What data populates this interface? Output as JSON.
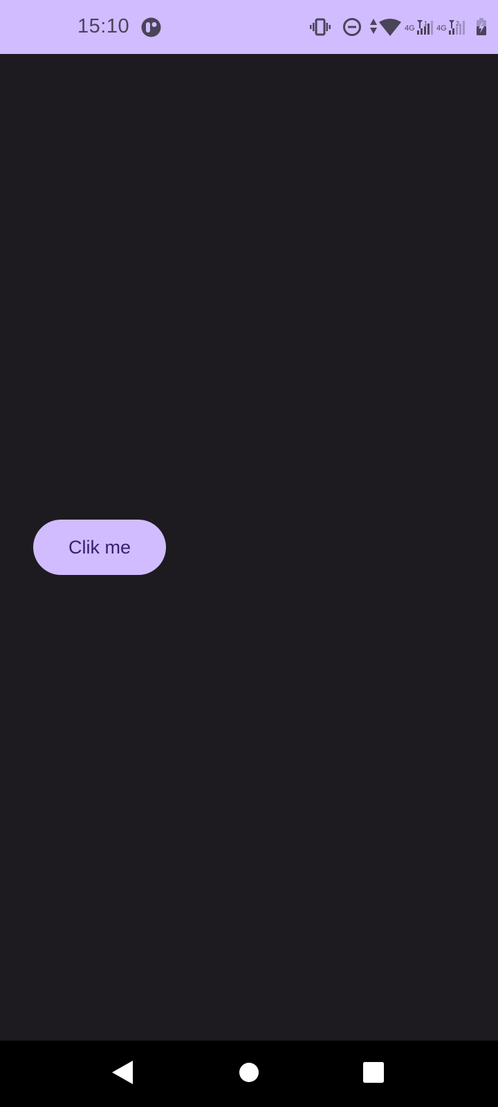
{
  "status_bar": {
    "time": "15:10",
    "icons": [
      "app-notification-icon",
      "vibrate-icon",
      "do-not-disturb-icon",
      "data-activity-icon",
      "wifi-icon",
      "signal-sim1-icon",
      "signal-sim2-icon",
      "battery-charging-icon"
    ],
    "network_sim1": "4G",
    "network_sim2": "4G",
    "sim1_index": "1",
    "sim2_index": "2"
  },
  "main": {
    "button_label": "Clik me"
  },
  "nav_bar": {
    "icons": [
      "back-icon",
      "home-icon",
      "recents-icon"
    ]
  },
  "colors": {
    "accent": "#d0bcff",
    "background": "#1d1b20",
    "button_text": "#381e72",
    "status_icons": "#4a4458",
    "nav_background": "#000000"
  }
}
